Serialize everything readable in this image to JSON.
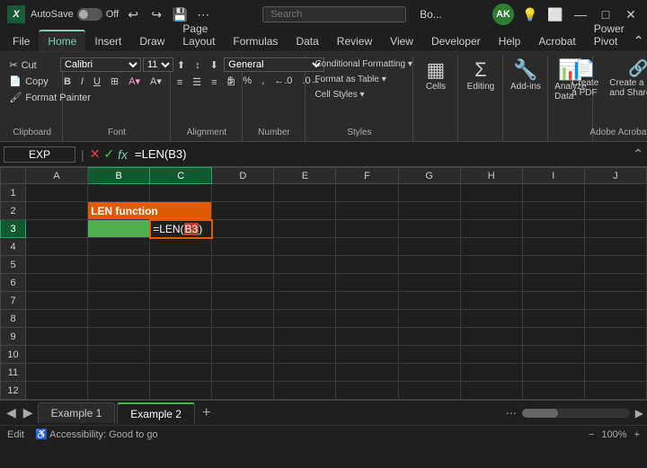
{
  "titlebar": {
    "app_icon": "X",
    "autosave_label": "AutoSave",
    "toggle_state": "Off",
    "filename": "Bo...",
    "search_placeholder": "Search",
    "user_initials": "AK",
    "undo_label": "↩",
    "redo_label": "↪",
    "minimize": "—",
    "maximize": "□",
    "close": "✕"
  },
  "ribbon_tabs": {
    "tabs": [
      "File",
      "Home",
      "Insert",
      "Draw",
      "Page Layout",
      "Formulas",
      "Data",
      "Review",
      "View",
      "Developer",
      "Help",
      "Acrobat",
      "Power Pivot"
    ],
    "active": "Home"
  },
  "ribbon": {
    "clipboard": {
      "label": "Clipboard",
      "icon": "📋"
    },
    "font": {
      "label": "Font",
      "icon": "A"
    },
    "alignment": {
      "label": "Alignment",
      "icon": "≡"
    },
    "number": {
      "label": "Number",
      "icon": "#"
    },
    "styles": {
      "label": "Styles",
      "cond_fmt": "Conditional Formatting ▾",
      "fmt_table": "Format as Table ▾",
      "cell_styles": "Cell Styles ▾"
    },
    "cells": {
      "label": "Cells",
      "icon": "▦"
    },
    "editing": {
      "label": "Editing",
      "icon": "Σ"
    },
    "addins": {
      "label": "Add-ins",
      "icon": "🔧"
    },
    "analyze": {
      "label": "Analyze Data",
      "icon": "📊"
    },
    "create_pdf": {
      "label": "Create a PDF",
      "icon": "📄"
    },
    "create_share": {
      "label": "Create a PDF and Share link",
      "icon": "🔗"
    },
    "adobe": {
      "label": "Adobe Acrobat"
    }
  },
  "formula_bar": {
    "name_box": "EXP",
    "cancel": "✕",
    "confirm": "✓",
    "fx": "fx",
    "formula": "=LEN(B3)"
  },
  "spreadsheet": {
    "columns": [
      "",
      "A",
      "B",
      "C",
      "D",
      "E",
      "F",
      "G",
      "H",
      "I",
      "J"
    ],
    "active_col": "C",
    "active_row": 3,
    "rows": [
      {
        "id": 1,
        "cells": [
          "",
          "",
          "",
          "",
          "",
          "",
          "",
          "",
          "",
          ""
        ]
      },
      {
        "id": 2,
        "cells": [
          "",
          "",
          "LEN function",
          "",
          "",
          "",
          "",
          "",
          "",
          ""
        ]
      },
      {
        "id": 3,
        "cells": [
          "",
          "",
          "=LEN(B3)",
          "",
          "",
          "",
          "",
          "",
          "",
          ""
        ]
      },
      {
        "id": 4,
        "cells": [
          "",
          "",
          "",
          "",
          "",
          "",
          "",
          "",
          "",
          ""
        ]
      },
      {
        "id": 5,
        "cells": [
          "",
          "",
          "",
          "",
          "",
          "",
          "",
          "",
          "",
          ""
        ]
      },
      {
        "id": 6,
        "cells": [
          "",
          "",
          "",
          "",
          "",
          "",
          "",
          "",
          "",
          ""
        ]
      },
      {
        "id": 7,
        "cells": [
          "",
          "",
          "",
          "",
          "",
          "",
          "",
          "",
          "",
          ""
        ]
      },
      {
        "id": 8,
        "cells": [
          "",
          "",
          "",
          "",
          "",
          "",
          "",
          "",
          "",
          ""
        ]
      },
      {
        "id": 9,
        "cells": [
          "",
          "",
          "",
          "",
          "",
          "",
          "",
          "",
          "",
          ""
        ]
      },
      {
        "id": 10,
        "cells": [
          "",
          "",
          "",
          "",
          "",
          "",
          "",
          "",
          "",
          ""
        ]
      },
      {
        "id": 11,
        "cells": [
          "",
          "",
          "",
          "",
          "",
          "",
          "",
          "",
          "",
          ""
        ]
      },
      {
        "id": 12,
        "cells": [
          "",
          "",
          "",
          "",
          "",
          "",
          "",
          "",
          "",
          ""
        ]
      }
    ]
  },
  "tabs_bar": {
    "sheets": [
      "Example 1",
      "Example 2"
    ],
    "active": "Example 2",
    "add_label": "+",
    "more_label": "⋯"
  },
  "status_bar": {
    "mode": "Edit",
    "accessibility": "♿ Accessibility: Good to go",
    "zoom": "100%",
    "zoom_out": "−",
    "zoom_in": "+"
  }
}
